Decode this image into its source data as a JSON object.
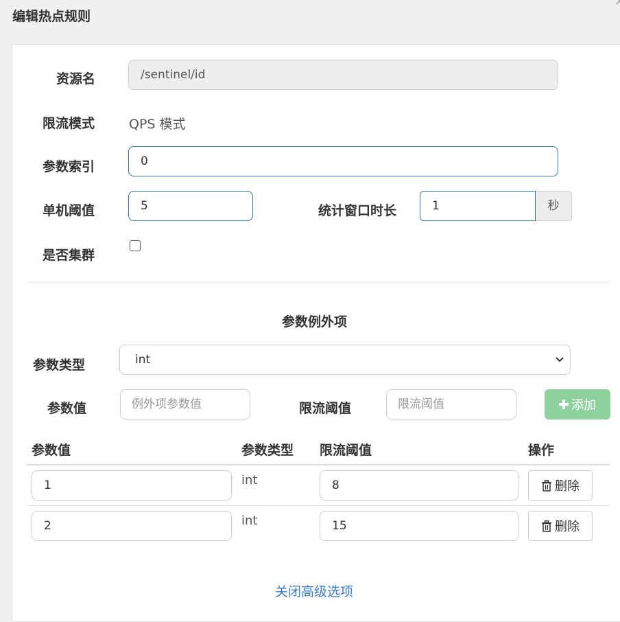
{
  "dialog": {
    "title": "编辑热点规则"
  },
  "form": {
    "resource_label": "资源名",
    "resource_value": "/sentinel/id",
    "mode_label": "限流模式",
    "mode_value": "QPS 模式",
    "param_index_label": "参数索引",
    "param_index_value": "0",
    "threshold_label": "单机阈值",
    "threshold_value": "5",
    "window_label": "统计窗口时长",
    "window_value": "1",
    "window_unit": "秒",
    "cluster_label": "是否集群",
    "cluster_checked": false
  },
  "exceptions": {
    "section_title": "参数例外项",
    "type_label": "参数类型",
    "type_selected": "int",
    "value_label": "参数值",
    "value_placeholder": "例外项参数值",
    "limit_label": "限流阈值",
    "limit_placeholder": "限流阈值",
    "add_label": "添加",
    "table": {
      "headers": [
        "参数值",
        "参数类型",
        "限流阈值",
        "操作"
      ],
      "rows": [
        {
          "value": "1",
          "type": "int",
          "limit": "8",
          "action": "删除"
        },
        {
          "value": "2",
          "type": "int",
          "limit": "15",
          "action": "删除"
        }
      ]
    }
  },
  "footer": {
    "toggle_link": "关闭高级选项"
  },
  "icons": {
    "close": "close-icon",
    "add": "plus-icon",
    "delete": "trash-icon",
    "select": "chevron-down-icon"
  },
  "colors": {
    "add_button": "#8fd19e",
    "focus_border": "#3c6ea8",
    "link": "#3a7bc0"
  }
}
